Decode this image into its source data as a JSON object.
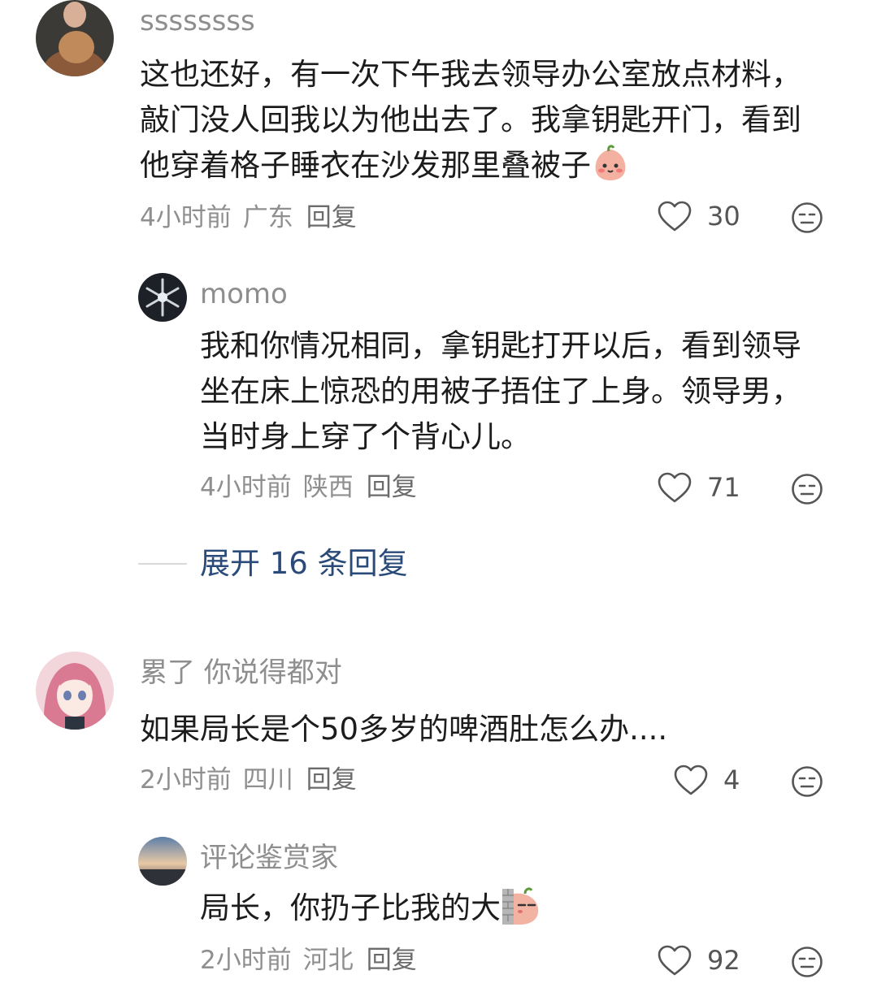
{
  "comments": [
    {
      "username": "ssssssss",
      "text": "这也还好，有一次下午我去领导办公室放点材料，敲门没人回我以为他出去了。我拿钥匙开门，看到他穿着格子睡衣在沙发那里叠被子",
      "emoji": "peach-face-emoji",
      "time": "4小时前",
      "location": "广东",
      "reply_label": "回复",
      "likes": "30"
    },
    {
      "username": "momo",
      "text": "我和你情况相同，拿钥匙打开以后，看到领导坐在床上惊恐的用被子捂住了上身。领导男，当时身上穿了个背心儿。",
      "time": "4小时前",
      "location": "陕西",
      "reply_label": "回复",
      "likes": "71"
    },
    {
      "username": "累了 你说得都对",
      "text": "如果局长是个50多岁的啤酒肚怎么办....",
      "time": "2小时前",
      "location": "四川",
      "reply_label": "回复",
      "likes": "4"
    },
    {
      "username": "评论鉴赏家",
      "text": "局长，你扔子比我的大",
      "emoji": "peeking-wall-emoji",
      "time": "2小时前",
      "location": "河北",
      "reply_label": "回复",
      "likes": "92"
    }
  ],
  "expand_replies": "展开 16 条回复",
  "colors": {
    "meta": "#8f8f8f",
    "expand": "#2a4a7a",
    "text": "#1c1c1c"
  }
}
